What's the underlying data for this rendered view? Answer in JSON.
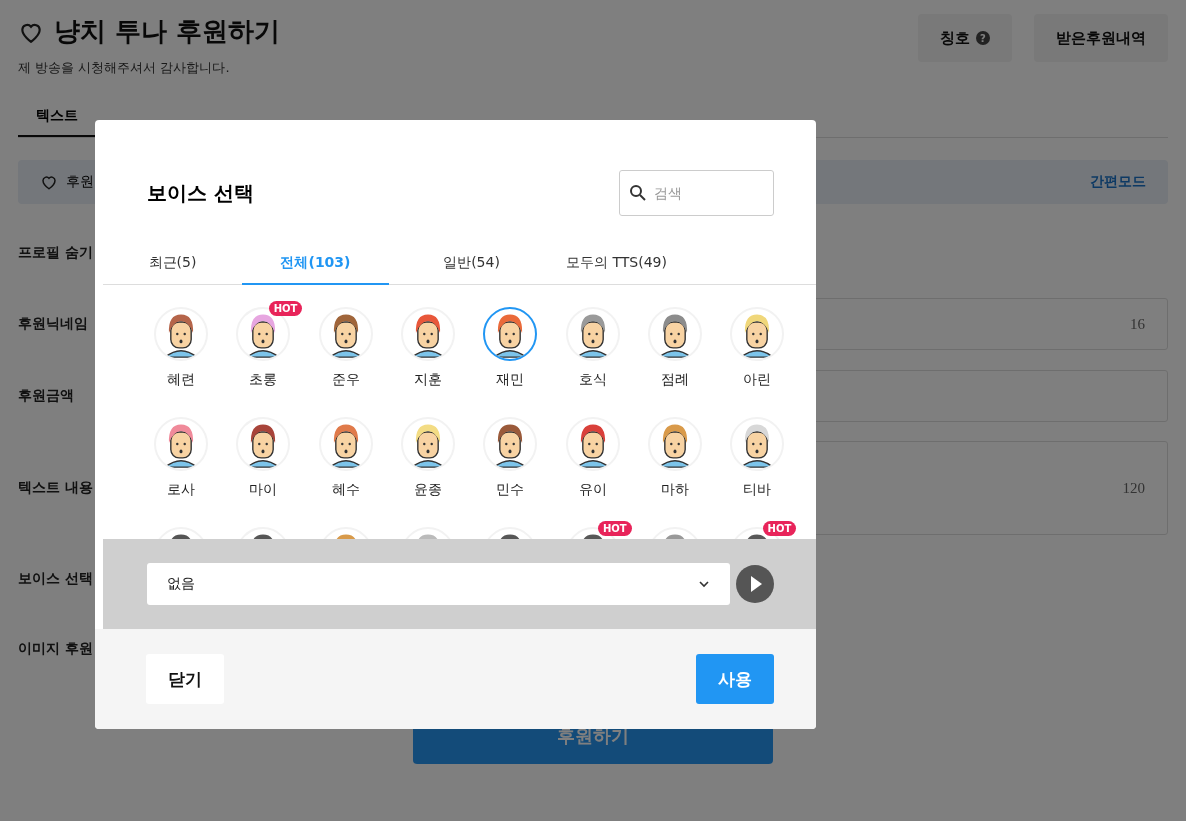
{
  "page": {
    "title": "냥치 투나 후원하기",
    "subtitle": "제 방송을 시청해주셔서 감사합니다.",
    "header_buttons": [
      {
        "label": "칭호",
        "help": "?"
      },
      {
        "label": "받은후원내역"
      }
    ],
    "tabs": [
      {
        "label": "텍스트",
        "selected": true
      }
    ],
    "notice": {
      "label": "후원",
      "link": "간편모드"
    },
    "rows": [
      {
        "label": "프로필 숨기",
        "kind": "plain"
      },
      {
        "label": "후원닉네임",
        "kind": "field",
        "counter": "16"
      },
      {
        "label": "후원금액",
        "kind": "field"
      },
      {
        "label": "텍스트 내용",
        "kind": "area",
        "counter": "120"
      },
      {
        "label": "보이스 선택",
        "kind": "plain"
      },
      {
        "label": "이미지 후원",
        "kind": "plain"
      }
    ],
    "submit": "후원하기"
  },
  "dialog": {
    "title": "보이스 선택",
    "search": {
      "placeholder": "검색"
    },
    "tabs": [
      {
        "label": "최근(5)",
        "selected": false
      },
      {
        "label": "전체(103)",
        "selected": true
      },
      {
        "label": "일반(54)",
        "selected": false
      },
      {
        "label": "모두의 TTS(49)",
        "selected": false
      }
    ],
    "voices": [
      {
        "name": "혜련",
        "selected": false,
        "color": "#b5654a"
      },
      {
        "name": "초롱",
        "badge": "HOT",
        "selected": false,
        "color": "#e7a6e0"
      },
      {
        "name": "준우",
        "selected": false,
        "color": "#a0653a"
      },
      {
        "name": "지훈",
        "selected": false,
        "color": "#e8573a"
      },
      {
        "name": "재민",
        "selected": true,
        "color": "#ea6a3a"
      },
      {
        "name": "호식",
        "selected": false,
        "color": "#9a9a9a"
      },
      {
        "name": "점례",
        "selected": false,
        "color": "#8c8c8c"
      },
      {
        "name": "아린",
        "selected": false,
        "color": "#f0d77a"
      },
      {
        "name": "로사",
        "selected": false,
        "color": "#f08a9a"
      },
      {
        "name": "마이",
        "selected": false,
        "color": "#a8443a"
      },
      {
        "name": "혜수",
        "selected": false,
        "color": "#e07a4a"
      },
      {
        "name": "윤종",
        "selected": false,
        "color": "#f3dc84"
      },
      {
        "name": "민수",
        "selected": false,
        "color": "#9a5a3a"
      },
      {
        "name": "유이",
        "selected": false,
        "color": "#d9403a"
      },
      {
        "name": "마하",
        "selected": false,
        "color": "#d99a4a"
      },
      {
        "name": "티바",
        "selected": false,
        "color": "#d8d8d8"
      },
      {
        "selected": false,
        "color": "#555555"
      },
      {
        "selected": false,
        "color": "#565656"
      },
      {
        "selected": false,
        "color": "#d89a4a"
      },
      {
        "selected": false,
        "color": "#bbbbbb"
      },
      {
        "selected": false,
        "color": "#575757"
      },
      {
        "badge": "HOT",
        "selected": false,
        "color": "#585858"
      },
      {
        "selected": false,
        "color": "#999999"
      },
      {
        "badge": "HOT",
        "selected": false,
        "color": "#595959"
      }
    ],
    "select": {
      "value": "없음"
    },
    "buttons": [
      {
        "label": "닫기",
        "kind": "secondary"
      },
      {
        "label": "사용",
        "kind": "primary"
      }
    ]
  }
}
